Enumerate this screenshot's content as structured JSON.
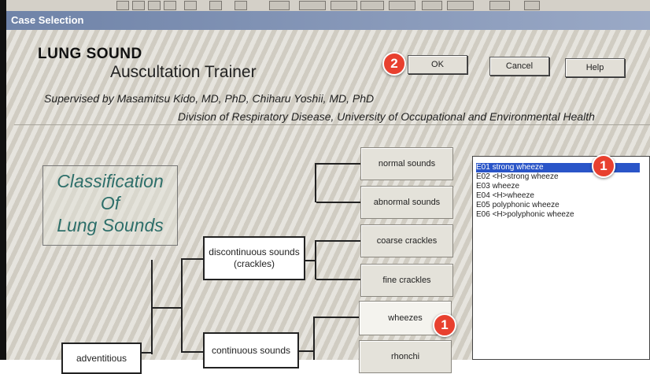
{
  "window": {
    "title": "Case Selection"
  },
  "header": {
    "title": "LUNG SOUND",
    "subtitle": "Auscultation Trainer",
    "credit_line1": "Supervised by Masamitsu Kido, MD, PhD,  Chiharu Yoshii, MD, PhD",
    "credit_line2": "Division of Respiratory Disease, University of Occupational and Environmental Health"
  },
  "buttons": {
    "ok": "OK",
    "cancel": "Cancel",
    "help": "Help"
  },
  "classification": {
    "line1": "Classification",
    "line2": "Of",
    "line3": "Lung Sounds"
  },
  "tree": {
    "adventitious": "adventitious",
    "discontinuous_line1": "discontinuous sounds",
    "discontinuous_line2": "(crackles)",
    "continuous": "continuous sounds",
    "normal": "normal  sounds",
    "abnormal": "abnormal sounds",
    "coarse": "coarse crackles",
    "fine": "fine crackles",
    "wheezes": "wheezes",
    "rhonchi": "rhonchi"
  },
  "case_list": {
    "selected_index": 0,
    "items": [
      "E01  strong wheeze",
      "E02 <H>strong wheeze",
      "E03   wheeze",
      "E04 <H>wheeze",
      "E05   polyphonic wheeze",
      "E06 <H>polyphonic wheeze"
    ]
  },
  "markers": {
    "list": "1",
    "ok": "2",
    "wheezes": "1"
  },
  "colors": {
    "marker": "#e8402f",
    "selection": "#2a55c8",
    "classification_text": "#2e6f6a"
  }
}
